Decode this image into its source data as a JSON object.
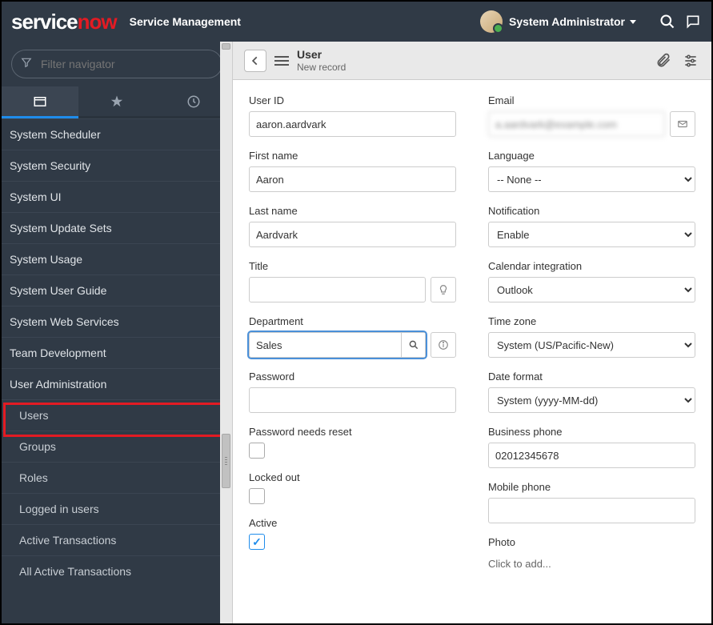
{
  "topbar": {
    "logo_part1": "service",
    "logo_part2": "now",
    "subtitle": "Service Management",
    "user_name": "System Administrator"
  },
  "sidebar": {
    "filter_placeholder": "Filter navigator",
    "items": [
      {
        "label": "System Scheduler",
        "sub": false
      },
      {
        "label": "System Security",
        "sub": false
      },
      {
        "label": "System UI",
        "sub": false
      },
      {
        "label": "System Update Sets",
        "sub": false
      },
      {
        "label": "System Usage",
        "sub": false
      },
      {
        "label": "System User Guide",
        "sub": false
      },
      {
        "label": "System Web Services",
        "sub": false
      },
      {
        "label": "Team Development",
        "sub": false
      },
      {
        "label": "User Administration",
        "sub": false
      },
      {
        "label": "Users",
        "sub": true,
        "highlight": true
      },
      {
        "label": "Groups",
        "sub": true
      },
      {
        "label": "Roles",
        "sub": true
      },
      {
        "label": "Logged in users",
        "sub": true
      },
      {
        "label": "Active Transactions",
        "sub": true
      },
      {
        "label": "All Active Transactions",
        "sub": true
      }
    ]
  },
  "form_header": {
    "title": "User",
    "subtitle": "New record"
  },
  "form": {
    "left": {
      "user_id": {
        "label": "User ID",
        "value": "aaron.aardvark"
      },
      "first_name": {
        "label": "First name",
        "value": "Aaron"
      },
      "last_name": {
        "label": "Last name",
        "value": "Aardvark"
      },
      "title": {
        "label": "Title",
        "value": ""
      },
      "department": {
        "label": "Department",
        "value": "Sales"
      },
      "password": {
        "label": "Password",
        "value": ""
      },
      "password_reset": {
        "label": "Password needs reset",
        "checked": false
      },
      "locked_out": {
        "label": "Locked out",
        "checked": false
      },
      "active": {
        "label": "Active",
        "checked": true
      }
    },
    "right": {
      "email": {
        "label": "Email",
        "value": "a.aardvark@example.com"
      },
      "language": {
        "label": "Language",
        "value": "-- None --"
      },
      "notification": {
        "label": "Notification",
        "value": "Enable"
      },
      "calendar": {
        "label": "Calendar integration",
        "value": "Outlook"
      },
      "timezone": {
        "label": "Time zone",
        "value": "System (US/Pacific-New)"
      },
      "date_format": {
        "label": "Date format",
        "value": "System (yyyy-MM-dd)"
      },
      "business_phone": {
        "label": "Business phone",
        "value": "02012345678"
      },
      "mobile_phone": {
        "label": "Mobile phone",
        "value": ""
      },
      "photo": {
        "label": "Photo",
        "add_text": "Click to add..."
      }
    }
  }
}
